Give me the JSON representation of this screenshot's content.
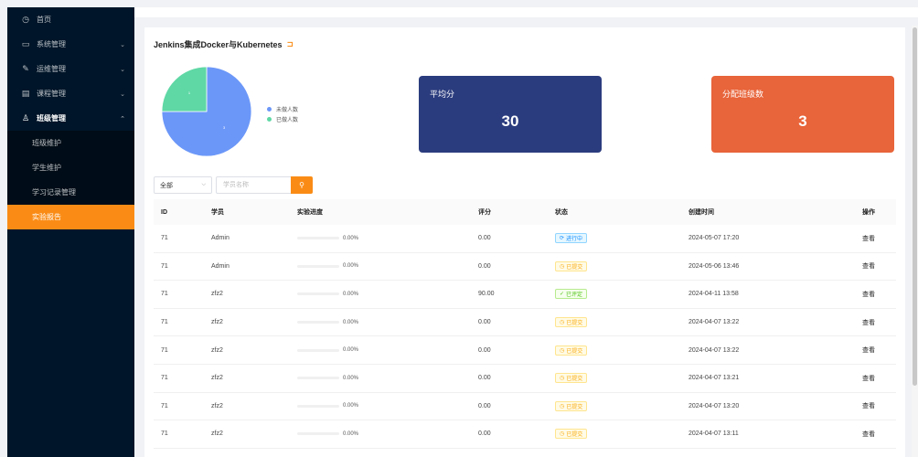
{
  "sidebar": {
    "items": [
      {
        "label": "首页",
        "icon": "clock-icon",
        "glyph": "◷",
        "chevron": ""
      },
      {
        "label": "系统管理",
        "icon": "monitor-icon",
        "glyph": "▭",
        "chevron": "⌄"
      },
      {
        "label": "运维管理",
        "icon": "wrench-icon",
        "glyph": "✎",
        "chevron": "⌄"
      },
      {
        "label": "课程管理",
        "icon": "document-icon",
        "glyph": "▤",
        "chevron": "⌄"
      },
      {
        "label": "班级管理",
        "icon": "users-icon",
        "glyph": "♙",
        "chevron": "⌃"
      }
    ],
    "subitems": [
      {
        "label": "班级维护"
      },
      {
        "label": "学生维护"
      },
      {
        "label": "学习记录管理"
      },
      {
        "label": "实验报告"
      }
    ]
  },
  "card": {
    "title": "Jenkins集成Docker与Kubernetes",
    "title_icon": "⊐"
  },
  "pie": {
    "legend": [
      {
        "label": "未做人数",
        "color": "#6b97f8"
      },
      {
        "label": "已做人数",
        "color": "#5fd8a5"
      }
    ],
    "slices": [
      {
        "label": "未做人数",
        "value": 3,
        "slice_label": "3",
        "color": "#6b97f8"
      },
      {
        "label": "已做人数",
        "value": 1,
        "slice_label": "1",
        "color": "#5fd8a5"
      }
    ]
  },
  "stats": {
    "avg_label": "平均分",
    "avg_value": "30",
    "class_label": "分配班级数",
    "class_value": "3"
  },
  "filters": {
    "select_value": "全部",
    "search_placeholder": "学员名称",
    "search_icon": "⚲"
  },
  "table": {
    "headers": [
      "ID",
      "学员",
      "实验进度",
      "评分",
      "状态",
      "创建时间",
      "操作"
    ],
    "rows": [
      {
        "id": "71",
        "student": "Admin",
        "progress": 0,
        "progress_text": "0.00%",
        "score": "0.00",
        "status": "进行中",
        "status_type": "blue",
        "status_icon": "⟳",
        "created": "2024-05-07 17:20",
        "action": "查看"
      },
      {
        "id": "71",
        "student": "Admin",
        "progress": 0,
        "progress_text": "0.00%",
        "score": "0.00",
        "status": "已提交",
        "status_type": "yellow",
        "status_icon": "◷",
        "created": "2024-05-06 13:46",
        "action": "查看"
      },
      {
        "id": "71",
        "student": "zfz2",
        "progress": 0,
        "progress_text": "0.00%",
        "score": "90.00",
        "status": "已评定",
        "status_type": "green",
        "status_icon": "✓",
        "created": "2024-04-11 13:58",
        "action": "查看"
      },
      {
        "id": "71",
        "student": "zfz2",
        "progress": 0,
        "progress_text": "0.00%",
        "score": "0.00",
        "status": "已提交",
        "status_type": "yellow",
        "status_icon": "◷",
        "created": "2024-04-07 13:22",
        "action": "查看"
      },
      {
        "id": "71",
        "student": "zfz2",
        "progress": 0,
        "progress_text": "0.00%",
        "score": "0.00",
        "status": "已提交",
        "status_type": "yellow",
        "status_icon": "◷",
        "created": "2024-04-07 13:22",
        "action": "查看"
      },
      {
        "id": "71",
        "student": "zfz2",
        "progress": 0,
        "progress_text": "0.00%",
        "score": "0.00",
        "status": "已提交",
        "status_type": "yellow",
        "status_icon": "◷",
        "created": "2024-04-07 13:21",
        "action": "查看"
      },
      {
        "id": "71",
        "student": "zfz2",
        "progress": 0,
        "progress_text": "0.00%",
        "score": "0.00",
        "status": "已提交",
        "status_type": "yellow",
        "status_icon": "◷",
        "created": "2024-04-07 13:20",
        "action": "查看"
      },
      {
        "id": "71",
        "student": "zfz2",
        "progress": 0,
        "progress_text": "0.00%",
        "score": "0.00",
        "status": "已提交",
        "status_type": "yellow",
        "status_icon": "◷",
        "created": "2024-04-07 13:11",
        "action": "查看"
      }
    ]
  }
}
